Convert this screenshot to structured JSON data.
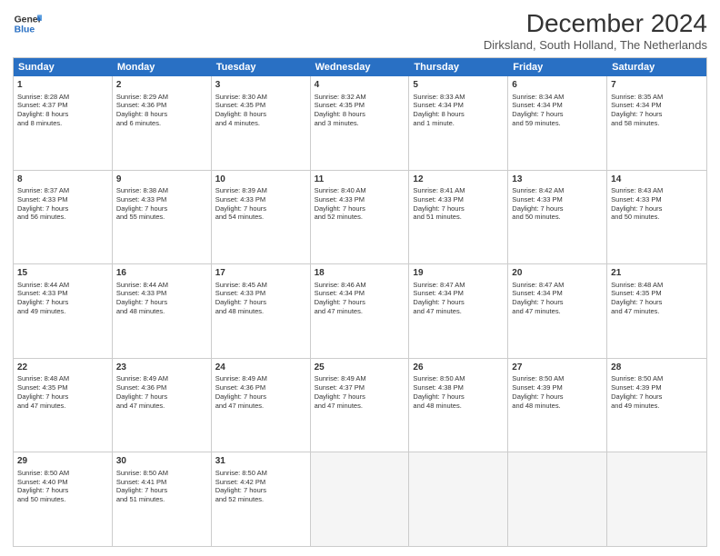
{
  "logo": {
    "line1": "General",
    "line2": "Blue"
  },
  "title": "December 2024",
  "subtitle": "Dirksland, South Holland, The Netherlands",
  "header_days": [
    "Sunday",
    "Monday",
    "Tuesday",
    "Wednesday",
    "Thursday",
    "Friday",
    "Saturday"
  ],
  "weeks": [
    [
      {
        "day": "1",
        "info": "Sunrise: 8:28 AM\nSunset: 4:37 PM\nDaylight: 8 hours\nand 8 minutes."
      },
      {
        "day": "2",
        "info": "Sunrise: 8:29 AM\nSunset: 4:36 PM\nDaylight: 8 hours\nand 6 minutes."
      },
      {
        "day": "3",
        "info": "Sunrise: 8:30 AM\nSunset: 4:35 PM\nDaylight: 8 hours\nand 4 minutes."
      },
      {
        "day": "4",
        "info": "Sunrise: 8:32 AM\nSunset: 4:35 PM\nDaylight: 8 hours\nand 3 minutes."
      },
      {
        "day": "5",
        "info": "Sunrise: 8:33 AM\nSunset: 4:34 PM\nDaylight: 8 hours\nand 1 minute."
      },
      {
        "day": "6",
        "info": "Sunrise: 8:34 AM\nSunset: 4:34 PM\nDaylight: 7 hours\nand 59 minutes."
      },
      {
        "day": "7",
        "info": "Sunrise: 8:35 AM\nSunset: 4:34 PM\nDaylight: 7 hours\nand 58 minutes."
      }
    ],
    [
      {
        "day": "8",
        "info": "Sunrise: 8:37 AM\nSunset: 4:33 PM\nDaylight: 7 hours\nand 56 minutes."
      },
      {
        "day": "9",
        "info": "Sunrise: 8:38 AM\nSunset: 4:33 PM\nDaylight: 7 hours\nand 55 minutes."
      },
      {
        "day": "10",
        "info": "Sunrise: 8:39 AM\nSunset: 4:33 PM\nDaylight: 7 hours\nand 54 minutes."
      },
      {
        "day": "11",
        "info": "Sunrise: 8:40 AM\nSunset: 4:33 PM\nDaylight: 7 hours\nand 52 minutes."
      },
      {
        "day": "12",
        "info": "Sunrise: 8:41 AM\nSunset: 4:33 PM\nDaylight: 7 hours\nand 51 minutes."
      },
      {
        "day": "13",
        "info": "Sunrise: 8:42 AM\nSunset: 4:33 PM\nDaylight: 7 hours\nand 50 minutes."
      },
      {
        "day": "14",
        "info": "Sunrise: 8:43 AM\nSunset: 4:33 PM\nDaylight: 7 hours\nand 50 minutes."
      }
    ],
    [
      {
        "day": "15",
        "info": "Sunrise: 8:44 AM\nSunset: 4:33 PM\nDaylight: 7 hours\nand 49 minutes."
      },
      {
        "day": "16",
        "info": "Sunrise: 8:44 AM\nSunset: 4:33 PM\nDaylight: 7 hours\nand 48 minutes."
      },
      {
        "day": "17",
        "info": "Sunrise: 8:45 AM\nSunset: 4:33 PM\nDaylight: 7 hours\nand 48 minutes."
      },
      {
        "day": "18",
        "info": "Sunrise: 8:46 AM\nSunset: 4:34 PM\nDaylight: 7 hours\nand 47 minutes."
      },
      {
        "day": "19",
        "info": "Sunrise: 8:47 AM\nSunset: 4:34 PM\nDaylight: 7 hours\nand 47 minutes."
      },
      {
        "day": "20",
        "info": "Sunrise: 8:47 AM\nSunset: 4:34 PM\nDaylight: 7 hours\nand 47 minutes."
      },
      {
        "day": "21",
        "info": "Sunrise: 8:48 AM\nSunset: 4:35 PM\nDaylight: 7 hours\nand 47 minutes."
      }
    ],
    [
      {
        "day": "22",
        "info": "Sunrise: 8:48 AM\nSunset: 4:35 PM\nDaylight: 7 hours\nand 47 minutes."
      },
      {
        "day": "23",
        "info": "Sunrise: 8:49 AM\nSunset: 4:36 PM\nDaylight: 7 hours\nand 47 minutes."
      },
      {
        "day": "24",
        "info": "Sunrise: 8:49 AM\nSunset: 4:36 PM\nDaylight: 7 hours\nand 47 minutes."
      },
      {
        "day": "25",
        "info": "Sunrise: 8:49 AM\nSunset: 4:37 PM\nDaylight: 7 hours\nand 47 minutes."
      },
      {
        "day": "26",
        "info": "Sunrise: 8:50 AM\nSunset: 4:38 PM\nDaylight: 7 hours\nand 48 minutes."
      },
      {
        "day": "27",
        "info": "Sunrise: 8:50 AM\nSunset: 4:39 PM\nDaylight: 7 hours\nand 48 minutes."
      },
      {
        "day": "28",
        "info": "Sunrise: 8:50 AM\nSunset: 4:39 PM\nDaylight: 7 hours\nand 49 minutes."
      }
    ],
    [
      {
        "day": "29",
        "info": "Sunrise: 8:50 AM\nSunset: 4:40 PM\nDaylight: 7 hours\nand 50 minutes."
      },
      {
        "day": "30",
        "info": "Sunrise: 8:50 AM\nSunset: 4:41 PM\nDaylight: 7 hours\nand 51 minutes."
      },
      {
        "day": "31",
        "info": "Sunrise: 8:50 AM\nSunset: 4:42 PM\nDaylight: 7 hours\nand 52 minutes."
      },
      {
        "day": "",
        "info": ""
      },
      {
        "day": "",
        "info": ""
      },
      {
        "day": "",
        "info": ""
      },
      {
        "day": "",
        "info": ""
      }
    ]
  ]
}
